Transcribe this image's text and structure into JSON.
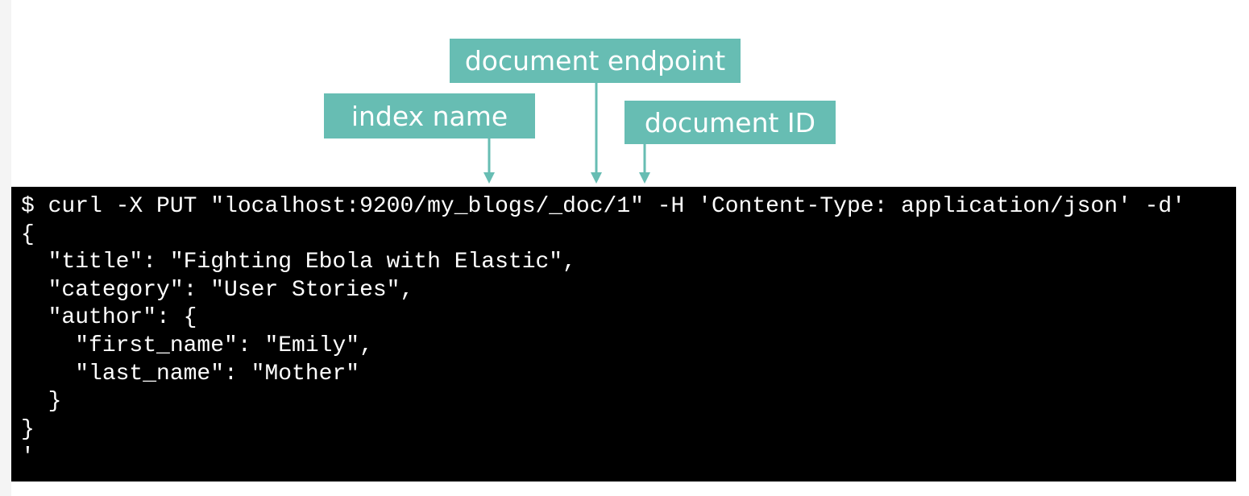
{
  "labels": {
    "document_endpoint": "document endpoint",
    "index_name": "index name",
    "document_id": "document ID"
  },
  "code_lines": [
    "$ curl -X PUT \"localhost:9200/my_blogs/_doc/1\" -H 'Content-Type: application/json' -d'",
    "{",
    "  \"title\": \"Fighting Ebola with Elastic\",",
    "  \"category\": \"User Stories\",",
    "  \"author\": {",
    "    \"first_name\": \"Emily\",",
    "    \"last_name\": \"Mother\"",
    "  }",
    "}",
    "'"
  ],
  "colors": {
    "label_background": "#67bdb3",
    "label_text": "#ffffff",
    "terminal_background": "#000000",
    "terminal_text": "#ffffff"
  }
}
